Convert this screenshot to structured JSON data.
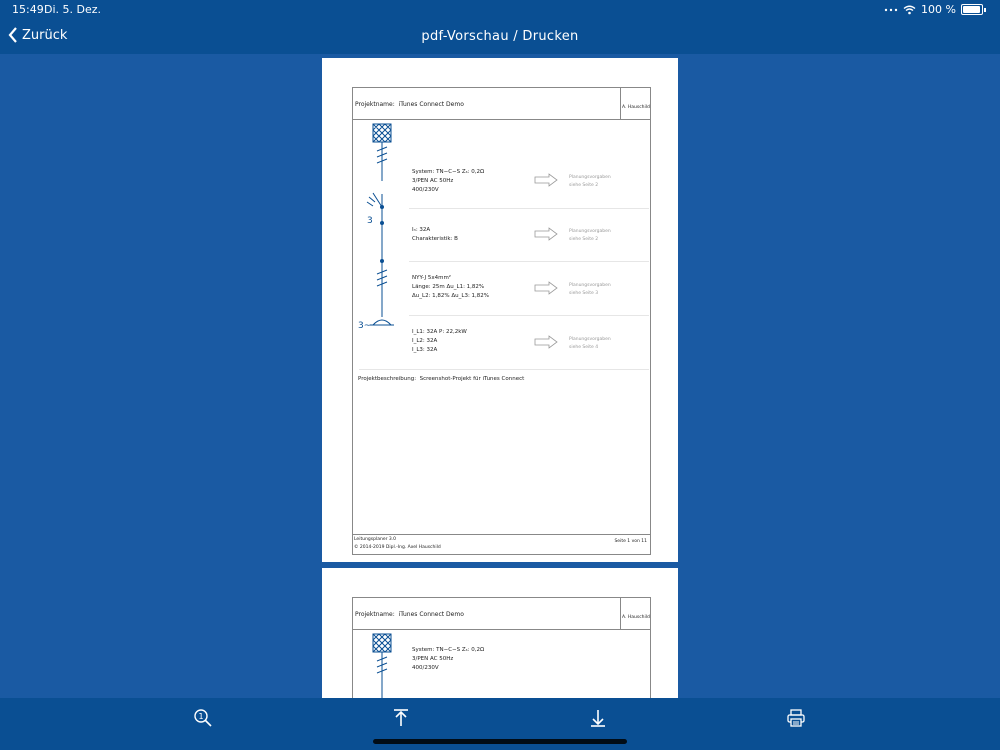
{
  "status": {
    "time": "15:49",
    "date": "Di. 5. Dez.",
    "battery": "100 %"
  },
  "nav": {
    "back_label": "Zurück",
    "title": "pdf-Vorschau / Drucken"
  },
  "doc": {
    "project_label": "Projektname:",
    "project_name": "iTunes Connect Demo",
    "author": "A. Hauschild",
    "system": [
      "System: TN−C−S   Zₛ: 0,2Ω",
      "3/PEN AC 50Hz",
      "400/230V"
    ],
    "breaker": [
      "Iₙ: 32A",
      "Charakteristik: B"
    ],
    "cable": [
      "NYY-J 5x4mm²",
      "Länge: 25m   Δu_L1: 1,82%",
      "Δu_L2: 1,82%   Δu_L3: 1,82%"
    ],
    "load": [
      "I_L1: 32A   P: 22,2kW",
      "I_L2: 32A",
      "I_L3: 32A"
    ],
    "hint_line1": "Planungsvorgaben",
    "hints": [
      "siehe Seite 2",
      "siehe Seite 2",
      "siehe Seite 3",
      "siehe Seite 4"
    ],
    "breaker_label": "3",
    "motor_label": "3~",
    "description_label": "Projektbeschreibung:",
    "description": "Screenshot-Projekt für iTunes Connect",
    "footer_app": "Leitungsplaner 3.0",
    "footer_copyright": "© 2014-2019 Dipl.-Ing. Axel Hauschild",
    "page_label": "Seite 1 von 11"
  },
  "colors": {
    "bar": "#0a4f93",
    "background": "#1a5aa3",
    "schematic": "#0a4f93"
  },
  "toolbar": [
    "zoom-icon",
    "upload-icon",
    "download-icon",
    "printer-icon"
  ]
}
